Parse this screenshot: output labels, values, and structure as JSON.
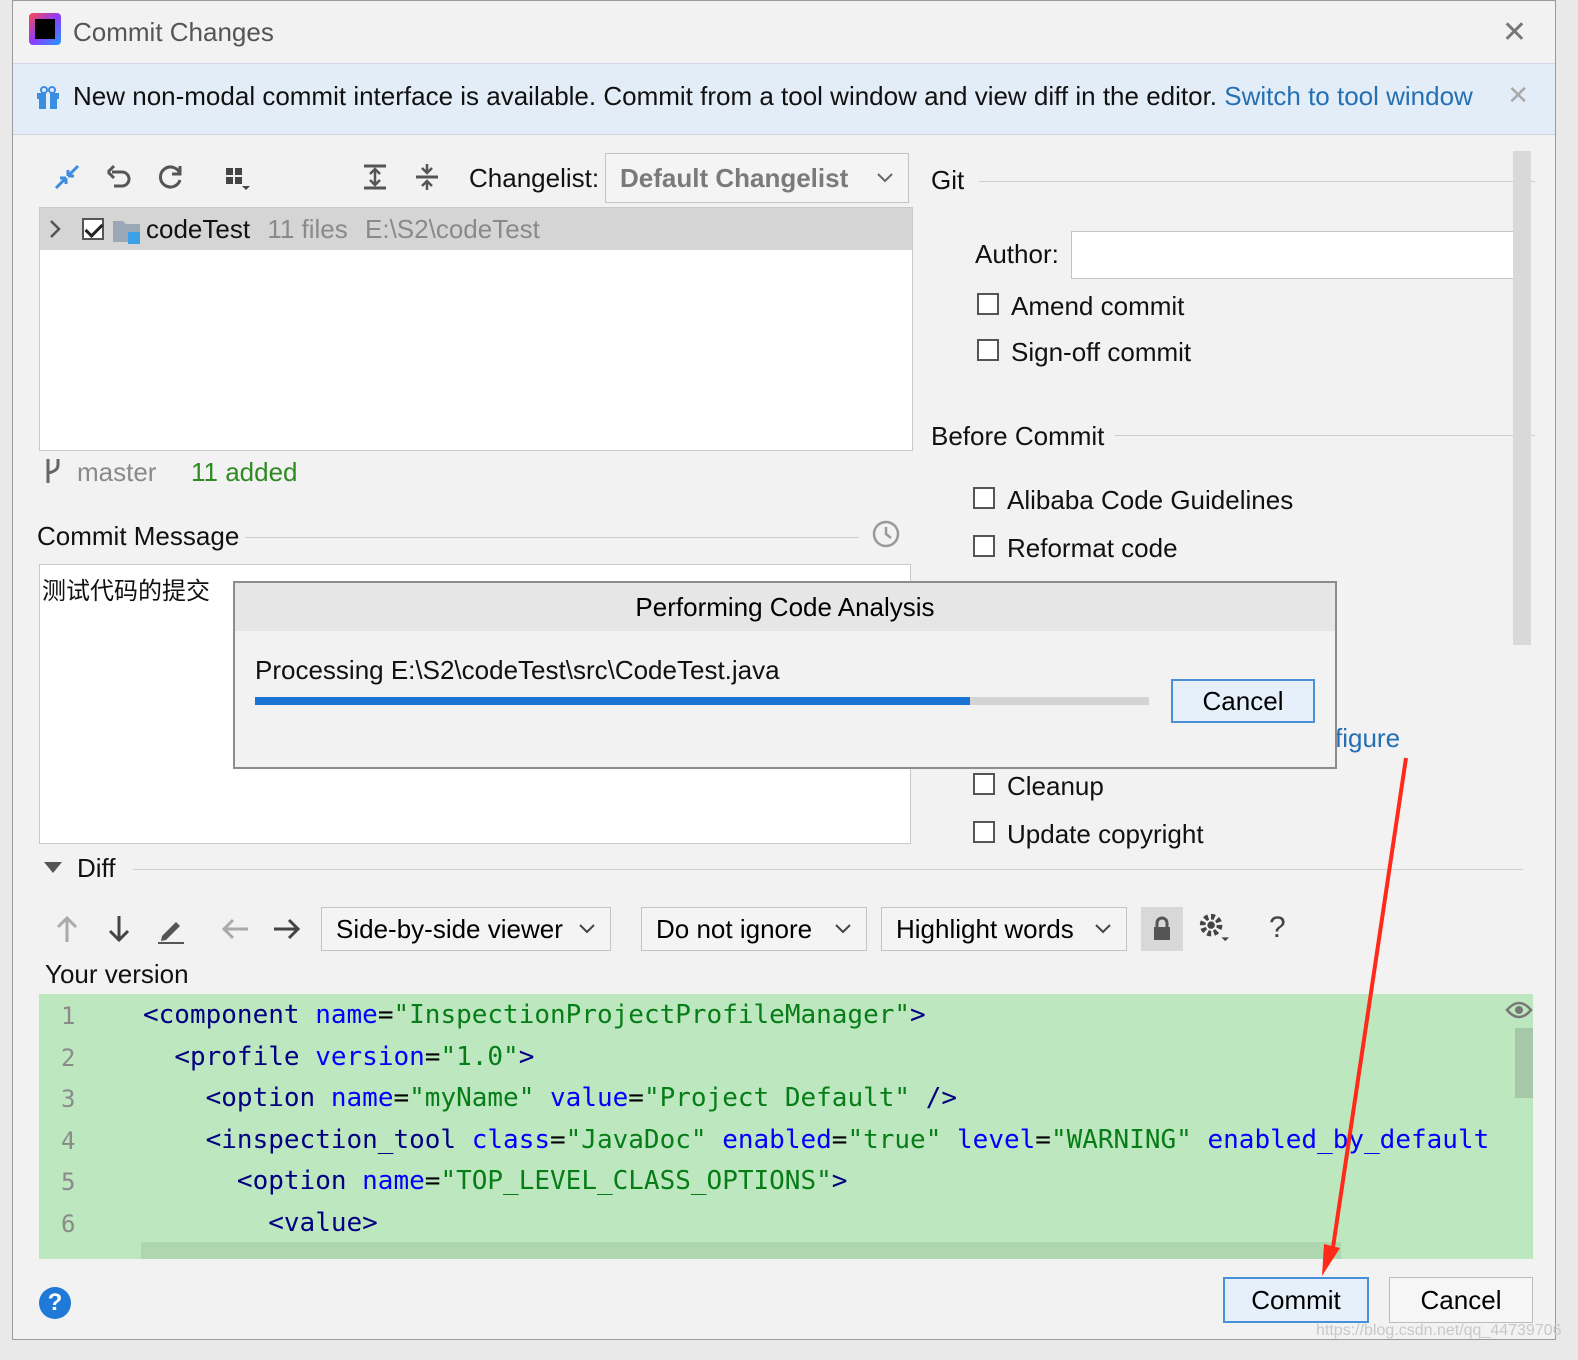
{
  "window": {
    "title": "Commit Changes"
  },
  "banner": {
    "text": "New non-modal commit interface is available. Commit from a tool window and view diff in the editor.",
    "link": "Switch to tool window"
  },
  "changes": {
    "changelist_label": "Changelist:",
    "changelist_value": "Default Changelist",
    "tree_row": {
      "name": "codeTest",
      "files": "11 files",
      "path": "E:\\S2\\codeTest",
      "checked": true
    },
    "branch": "master",
    "added": "11 added"
  },
  "commit_message": {
    "label": "Commit Message",
    "text": "测试代码的提交"
  },
  "git": {
    "section_label": "Git",
    "author_label": "Author:",
    "author_value": "",
    "amend": "Amend commit",
    "signoff": "Sign-off commit"
  },
  "before_commit": {
    "section_label": "Before Commit",
    "items": [
      "Alibaba Code Guidelines",
      "Reformat code",
      "Cleanup",
      "Update copyright"
    ],
    "configure_partial": "figure"
  },
  "progress_dialog": {
    "title": "Performing Code Analysis",
    "text": "Processing E:\\S2\\codeTest\\src\\CodeTest.java",
    "progress": 0.8,
    "cancel": "Cancel"
  },
  "diff": {
    "label": "Diff",
    "viewer": "Side-by-side viewer",
    "ignore": "Do not ignore",
    "highlight": "Highlight words",
    "help": "?",
    "your_version": "Your version",
    "lines": [
      {
        "n": "1",
        "indent": "",
        "tag": "<component",
        "attrs": [
          [
            "name",
            "\"InspectionProjectProfileManager\""
          ]
        ],
        "end": ">"
      },
      {
        "n": "2",
        "indent": "  ",
        "tag": "<profile",
        "attrs": [
          [
            "version",
            "\"1.0\""
          ]
        ],
        "end": ">"
      },
      {
        "n": "3",
        "indent": "    ",
        "tag": "<option",
        "attrs": [
          [
            "name",
            "\"myName\""
          ],
          [
            "value",
            "\"Project Default\""
          ]
        ],
        "end": " />"
      },
      {
        "n": "4",
        "indent": "    ",
        "tag": "<inspection_tool",
        "attrs": [
          [
            "class",
            "\"JavaDoc\""
          ],
          [
            "enabled",
            "\"true\""
          ],
          [
            "level",
            "\"WARNING\""
          ],
          [
            "enabled_by_default",
            ""
          ]
        ],
        "end": ""
      },
      {
        "n": "5",
        "indent": "      ",
        "tag": "<option",
        "attrs": [
          [
            "name",
            "\"TOP_LEVEL_CLASS_OPTIONS\""
          ]
        ],
        "end": ">"
      },
      {
        "n": "6",
        "indent": "        ",
        "tag": "<value",
        "attrs": [],
        "end": ">"
      }
    ]
  },
  "footer": {
    "commit": "Commit",
    "cancel": "Cancel",
    "help": "?"
  },
  "watermark": "https://blog.csdn.net/qq_44739706",
  "colors": {
    "accent": "#1b74d3",
    "diff_added_bg": "#bde7bf",
    "annotation_arrow": "#ff2a1a"
  }
}
